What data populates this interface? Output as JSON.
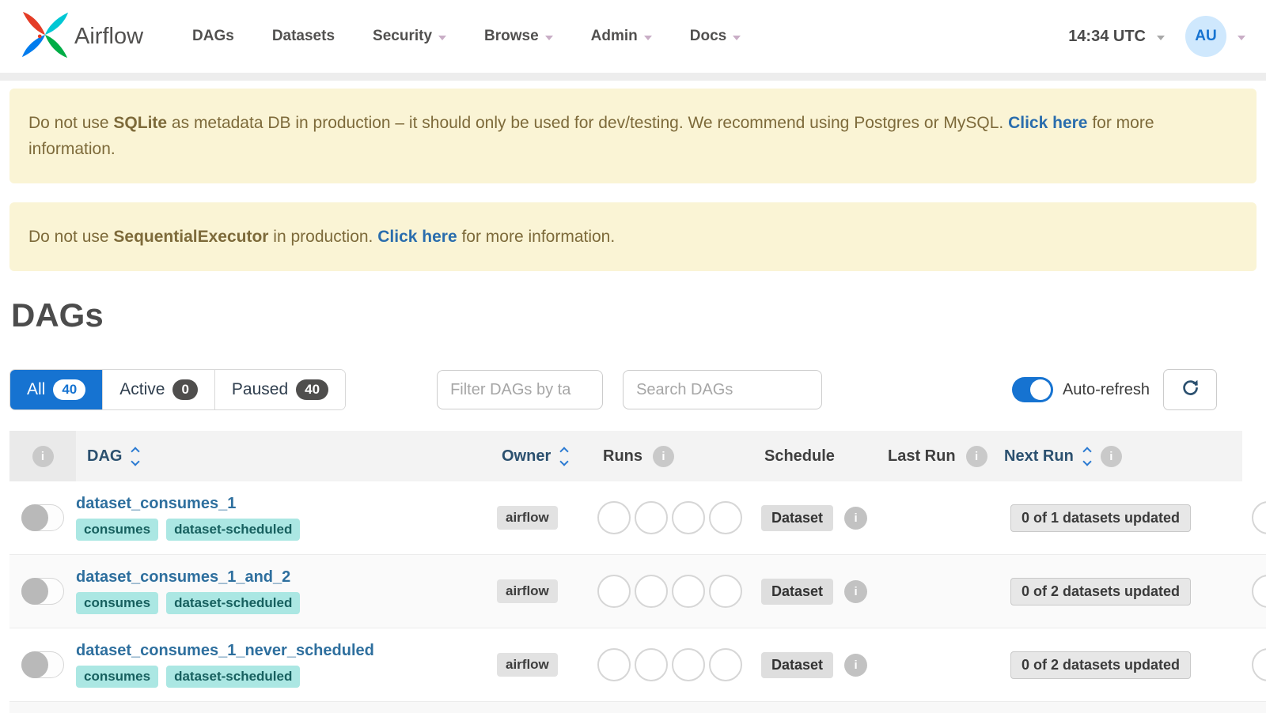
{
  "colors": {
    "accent_blue": "#1673d1",
    "link_blue": "#2a6dad",
    "dag_link_blue": "#2e6f9e",
    "warning_bg": "#faf4d5",
    "warning_text": "#7d6a3a",
    "tag_bg": "#abe7e3",
    "tag_text": "#17605f"
  },
  "icons": {
    "info": "i"
  },
  "navbar": {
    "brand": "Airflow",
    "items": [
      {
        "label": "DAGs"
      },
      {
        "label": "Datasets"
      },
      {
        "label": "Security"
      },
      {
        "label": "Browse"
      },
      {
        "label": "Admin"
      },
      {
        "label": "Docs"
      }
    ],
    "clock": "14:34 UTC",
    "avatar_initials": "AU"
  },
  "alerts": [
    {
      "parts": [
        {
          "t": "Do not use "
        },
        {
          "t": "SQLite"
        },
        {
          "t": " as metadata DB in production – it should only be used for dev/testing. We recommend using Postgres or MySQL. "
        },
        {
          "t": "Click here"
        },
        {
          "t": " for more information."
        }
      ]
    },
    {
      "parts": [
        {
          "t": "Do not use "
        },
        {
          "t": "SequentialExecutor"
        },
        {
          "t": " in production. "
        },
        {
          "t": "Click here"
        },
        {
          "t": " for more information."
        }
      ]
    }
  ],
  "page_title": "DAGs",
  "filters": {
    "tabs": [
      {
        "label": "All",
        "count": 40
      },
      {
        "label": "Active",
        "count": 0
      },
      {
        "label": "Paused",
        "count": 40
      }
    ],
    "tag_filter_placeholder": "Filter DAGs by ta",
    "search_placeholder": "Search DAGs",
    "auto_refresh_label": "Auto-refresh"
  },
  "table": {
    "columns": [
      {
        "label": "DAG"
      },
      {
        "label": "Owner"
      },
      {
        "label": "Runs"
      },
      {
        "label": "Schedule"
      },
      {
        "label": "Last Run"
      },
      {
        "label": "Next Run"
      }
    ],
    "rows": [
      {
        "name": "dataset_consumes_1",
        "tags": [
          "consumes",
          "dataset-scheduled"
        ],
        "owner": "airflow",
        "schedule": "Dataset",
        "last_run": "",
        "next_run": "0 of 1 datasets updated"
      },
      {
        "name": "dataset_consumes_1_and_2",
        "tags": [
          "consumes",
          "dataset-scheduled"
        ],
        "owner": "airflow",
        "schedule": "Dataset",
        "last_run": "",
        "next_run": "0 of 2 datasets updated"
      },
      {
        "name": "dataset_consumes_1_never_scheduled",
        "tags": [
          "consumes",
          "dataset-scheduled"
        ],
        "owner": "airflow",
        "schedule": "Dataset",
        "last_run": "",
        "next_run": "0 of 2 datasets updated"
      }
    ]
  }
}
